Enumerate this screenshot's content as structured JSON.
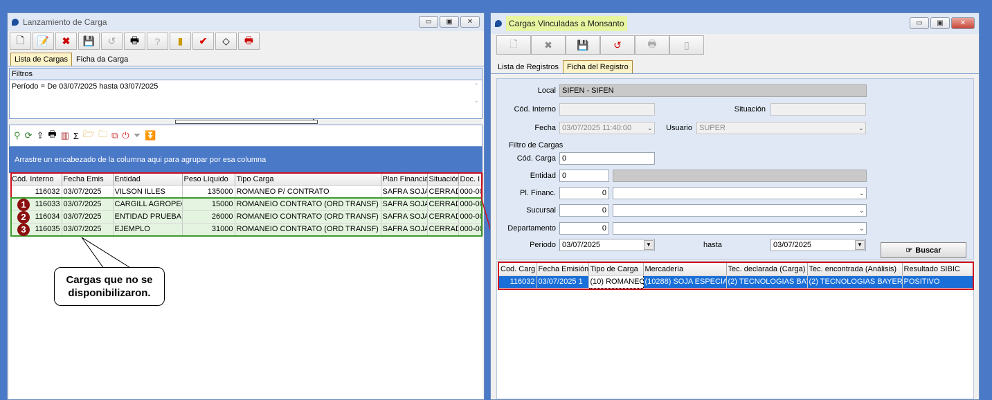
{
  "left_window": {
    "title": "Lanzamiento de Carga",
    "tabs": [
      "Lista de Cargas",
      "Ficha da Carga"
    ],
    "filters_label": "Filtros",
    "filter_text": "Período = De 03/07/2025 hasta 03/07/2025",
    "group_hint": "Arrastre un encabezado de la columna aqui para agrupar por esa columna",
    "columns": [
      "Cód. Interno",
      "Fecha Emis",
      "Entidad",
      "Peso Líquido",
      "Tipo Carga",
      "Plan Financia",
      "Situación",
      "Doc. I"
    ],
    "rows": [
      [
        "116032",
        "03/07/2025",
        "VILSON ILLES",
        "135000",
        "ROMANEO P/ CONTRATO",
        "SAFRA SOJA",
        "CERRAD",
        "000-00"
      ],
      [
        "116033",
        "03/07/2025",
        "CARGILL AGROPECU",
        "15000",
        "ROMANEIO CONTRATO (ORD TRANSF)",
        "SAFRA SOJA",
        "CERRAD",
        "000-00"
      ],
      [
        "116034",
        "03/07/2025",
        "ENTIDAD PRUEBA",
        "26000",
        "ROMANEIO CONTRATO (ORD TRANSF)",
        "SAFRA SOJA",
        "CERRAD",
        "000-00"
      ],
      [
        "116035",
        "03/07/2025",
        "EJEMPLO",
        "31000",
        "ROMANEIO CONTRATO (ORD TRANSF)",
        "SAFRA SOJA",
        "CERRAD",
        "000-00"
      ]
    ],
    "markers": [
      "1",
      "2",
      "3"
    ],
    "callout": "Cargas que no se disponibilizaron."
  },
  "right_window": {
    "title": "Cargas Vinculadas a Monsanto",
    "tabs": [
      "Lista de Registros",
      "Ficha del Registro"
    ],
    "labels": {
      "local": "Local",
      "cod_interno": "Cód. Interno",
      "situacion": "Situación",
      "fecha": "Fecha",
      "usuario": "Usuario",
      "filtro": "Filtro de Cargas",
      "cod_carga": "Cód. Carga",
      "entidad": "Entidad",
      "pl_financ": "Pl. Financ.",
      "sucursal": "Sucursal",
      "departamento": "Departamento",
      "periodo": "Periodo",
      "hasta": "hasta",
      "buscar": "Buscar"
    },
    "values": {
      "local": "SIFEN - SIFEN",
      "fecha": "03/07/2025 11:40:00",
      "usuario": "SUPER",
      "cod_carga": "0",
      "entidad": "0",
      "pl_financ": "0",
      "sucursal": "0",
      "departamento": "0",
      "periodo_desde": "03/07/2025",
      "periodo_hasta": "03/07/2025"
    },
    "columns": [
      "Cod. Carg",
      "Fecha Emisión",
      "Tipo de Carga",
      "Mercadería",
      "Tec. declarada (Carga)",
      "Tec. encontrada (Análisis)",
      "Resultado SIBIC"
    ],
    "rows": [
      [
        "116032",
        "03/07/2025 1",
        "(10) ROMANEO",
        "(10288) SOJA ESPECIA",
        "(2) TECNOLOGIAS BAY",
        "(2) TECNOLOGIAS BAYER",
        "POSITIVO"
      ]
    ]
  },
  "colors": {
    "accent_blue": "#4a79c7",
    "highlight_red": "#d01020",
    "highlight_green": "#3c9a2c",
    "selected_row": "#1a6fd8"
  }
}
